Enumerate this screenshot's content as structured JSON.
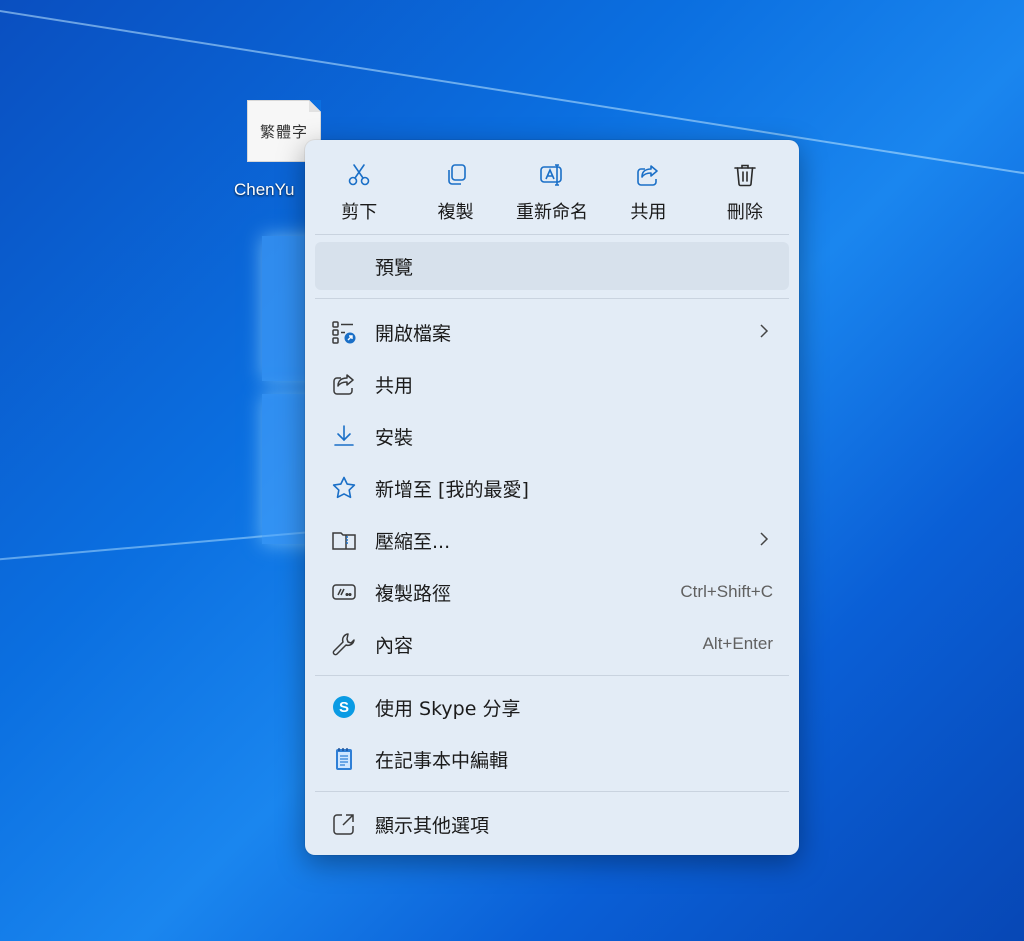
{
  "desktop": {
    "file_thumbnail_text": "繁體字",
    "file_name": "ChenYu"
  },
  "context_menu": {
    "quick_actions": [
      {
        "label": "剪下",
        "icon": "scissors-icon"
      },
      {
        "label": "複製",
        "icon": "copy-icon"
      },
      {
        "label": "重新命名",
        "icon": "rename-icon"
      },
      {
        "label": "共用",
        "icon": "share-icon"
      },
      {
        "label": "刪除",
        "icon": "trash-icon"
      }
    ],
    "preview_label": "預覽",
    "items": [
      {
        "label": "開啟檔案",
        "icon": "open-with-icon",
        "has_submenu": true
      },
      {
        "label": "共用",
        "icon": "share-icon"
      },
      {
        "label": "安裝",
        "icon": "download-icon"
      },
      {
        "label": "新增至 [我的最愛]",
        "icon": "star-icon"
      },
      {
        "label": "壓縮至...",
        "icon": "zip-folder-icon",
        "has_submenu": true
      },
      {
        "label": "複製路徑",
        "icon": "copy-path-icon",
        "shortcut": "Ctrl+Shift+C"
      },
      {
        "label": "內容",
        "icon": "wrench-icon",
        "shortcut": "Alt+Enter"
      },
      {
        "label": "使用 Skype 分享",
        "icon": "skype-icon"
      },
      {
        "label": "在記事本中編輯",
        "icon": "notepad-icon"
      },
      {
        "label": "顯示其他選項",
        "icon": "show-more-options-icon"
      }
    ]
  },
  "colors": {
    "accent": "#1a6fc7",
    "menu_background": "#e3ecf6",
    "hover_row": "#d7e1ec",
    "skype_blue": "#0a9be4",
    "notepad_blue": "#2f7fd6"
  }
}
